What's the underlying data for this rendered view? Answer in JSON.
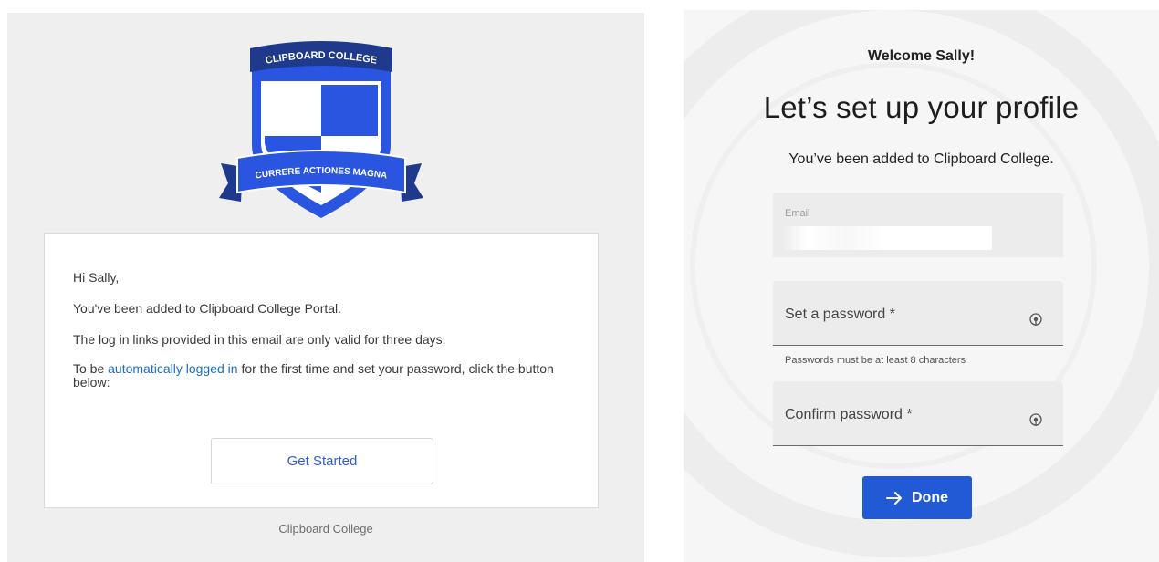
{
  "email": {
    "crest": {
      "top_banner": "CLIPBOARD COLLEGE",
      "bottom_banner": "CURRERE ACTIONES MAGNA",
      "colors": {
        "blue": "#2a55e0",
        "navy": "#1f3a8c",
        "white": "#ffffff"
      }
    },
    "greeting": "Hi Sally,",
    "line1": "You've been added to Clipboard College Portal.",
    "line2": "The log in links provided in this email are only valid for three days.",
    "line3_before": "To be ",
    "line3_link": "automatically logged in",
    "line3_after": " for the first time and set your password, click the button below:",
    "button_label": "Get Started",
    "footer": "Clipboard College"
  },
  "profile": {
    "welcome": "Welcome Sally!",
    "headline": "Let’s set up your profile",
    "subhead": "You’ve been added to Clipboard College.",
    "email_field": {
      "label": "Email"
    },
    "password_field": {
      "label": "Set a password *",
      "icon": "eye-icon"
    },
    "password_helper": "Passwords must be at least 8 characters",
    "confirm_field": {
      "label": "Confirm password *",
      "icon": "eye-icon"
    },
    "done_button": {
      "label": "Done",
      "icon": "arrow-right-icon"
    },
    "accent_color": "#2259d4"
  }
}
